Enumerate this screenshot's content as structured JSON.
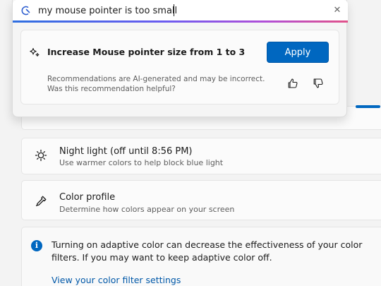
{
  "search": {
    "query": "my mouse pointer is too small",
    "clear_glyph": "✕"
  },
  "recommendation": {
    "title": "Increase Mouse pointer size from 1 to 3",
    "apply_label": "Apply",
    "disclaimer": "Recommendations are AI-generated and may be incorrect. Was this recommendation helpful?"
  },
  "settings": {
    "night_light": {
      "title": "Night light (off until 8:56 PM)",
      "subtitle": "Use warmer colors to help block blue light",
      "icon": "sun-icon"
    },
    "color_profile": {
      "title": "Color profile",
      "subtitle": "Determine how colors appear on your screen",
      "icon": "eyedropper-icon"
    },
    "info": {
      "text": "Turning on adaptive color can decrease the effectiveness of your color filters. If you may want to keep adaptive color off.",
      "link": "View your color filter settings",
      "icon": "info-icon"
    }
  },
  "colors": {
    "accent": "#0067c0",
    "link": "#0058a8",
    "gradient_start": "#2f6fe0",
    "gradient_end": "#e1528a"
  }
}
